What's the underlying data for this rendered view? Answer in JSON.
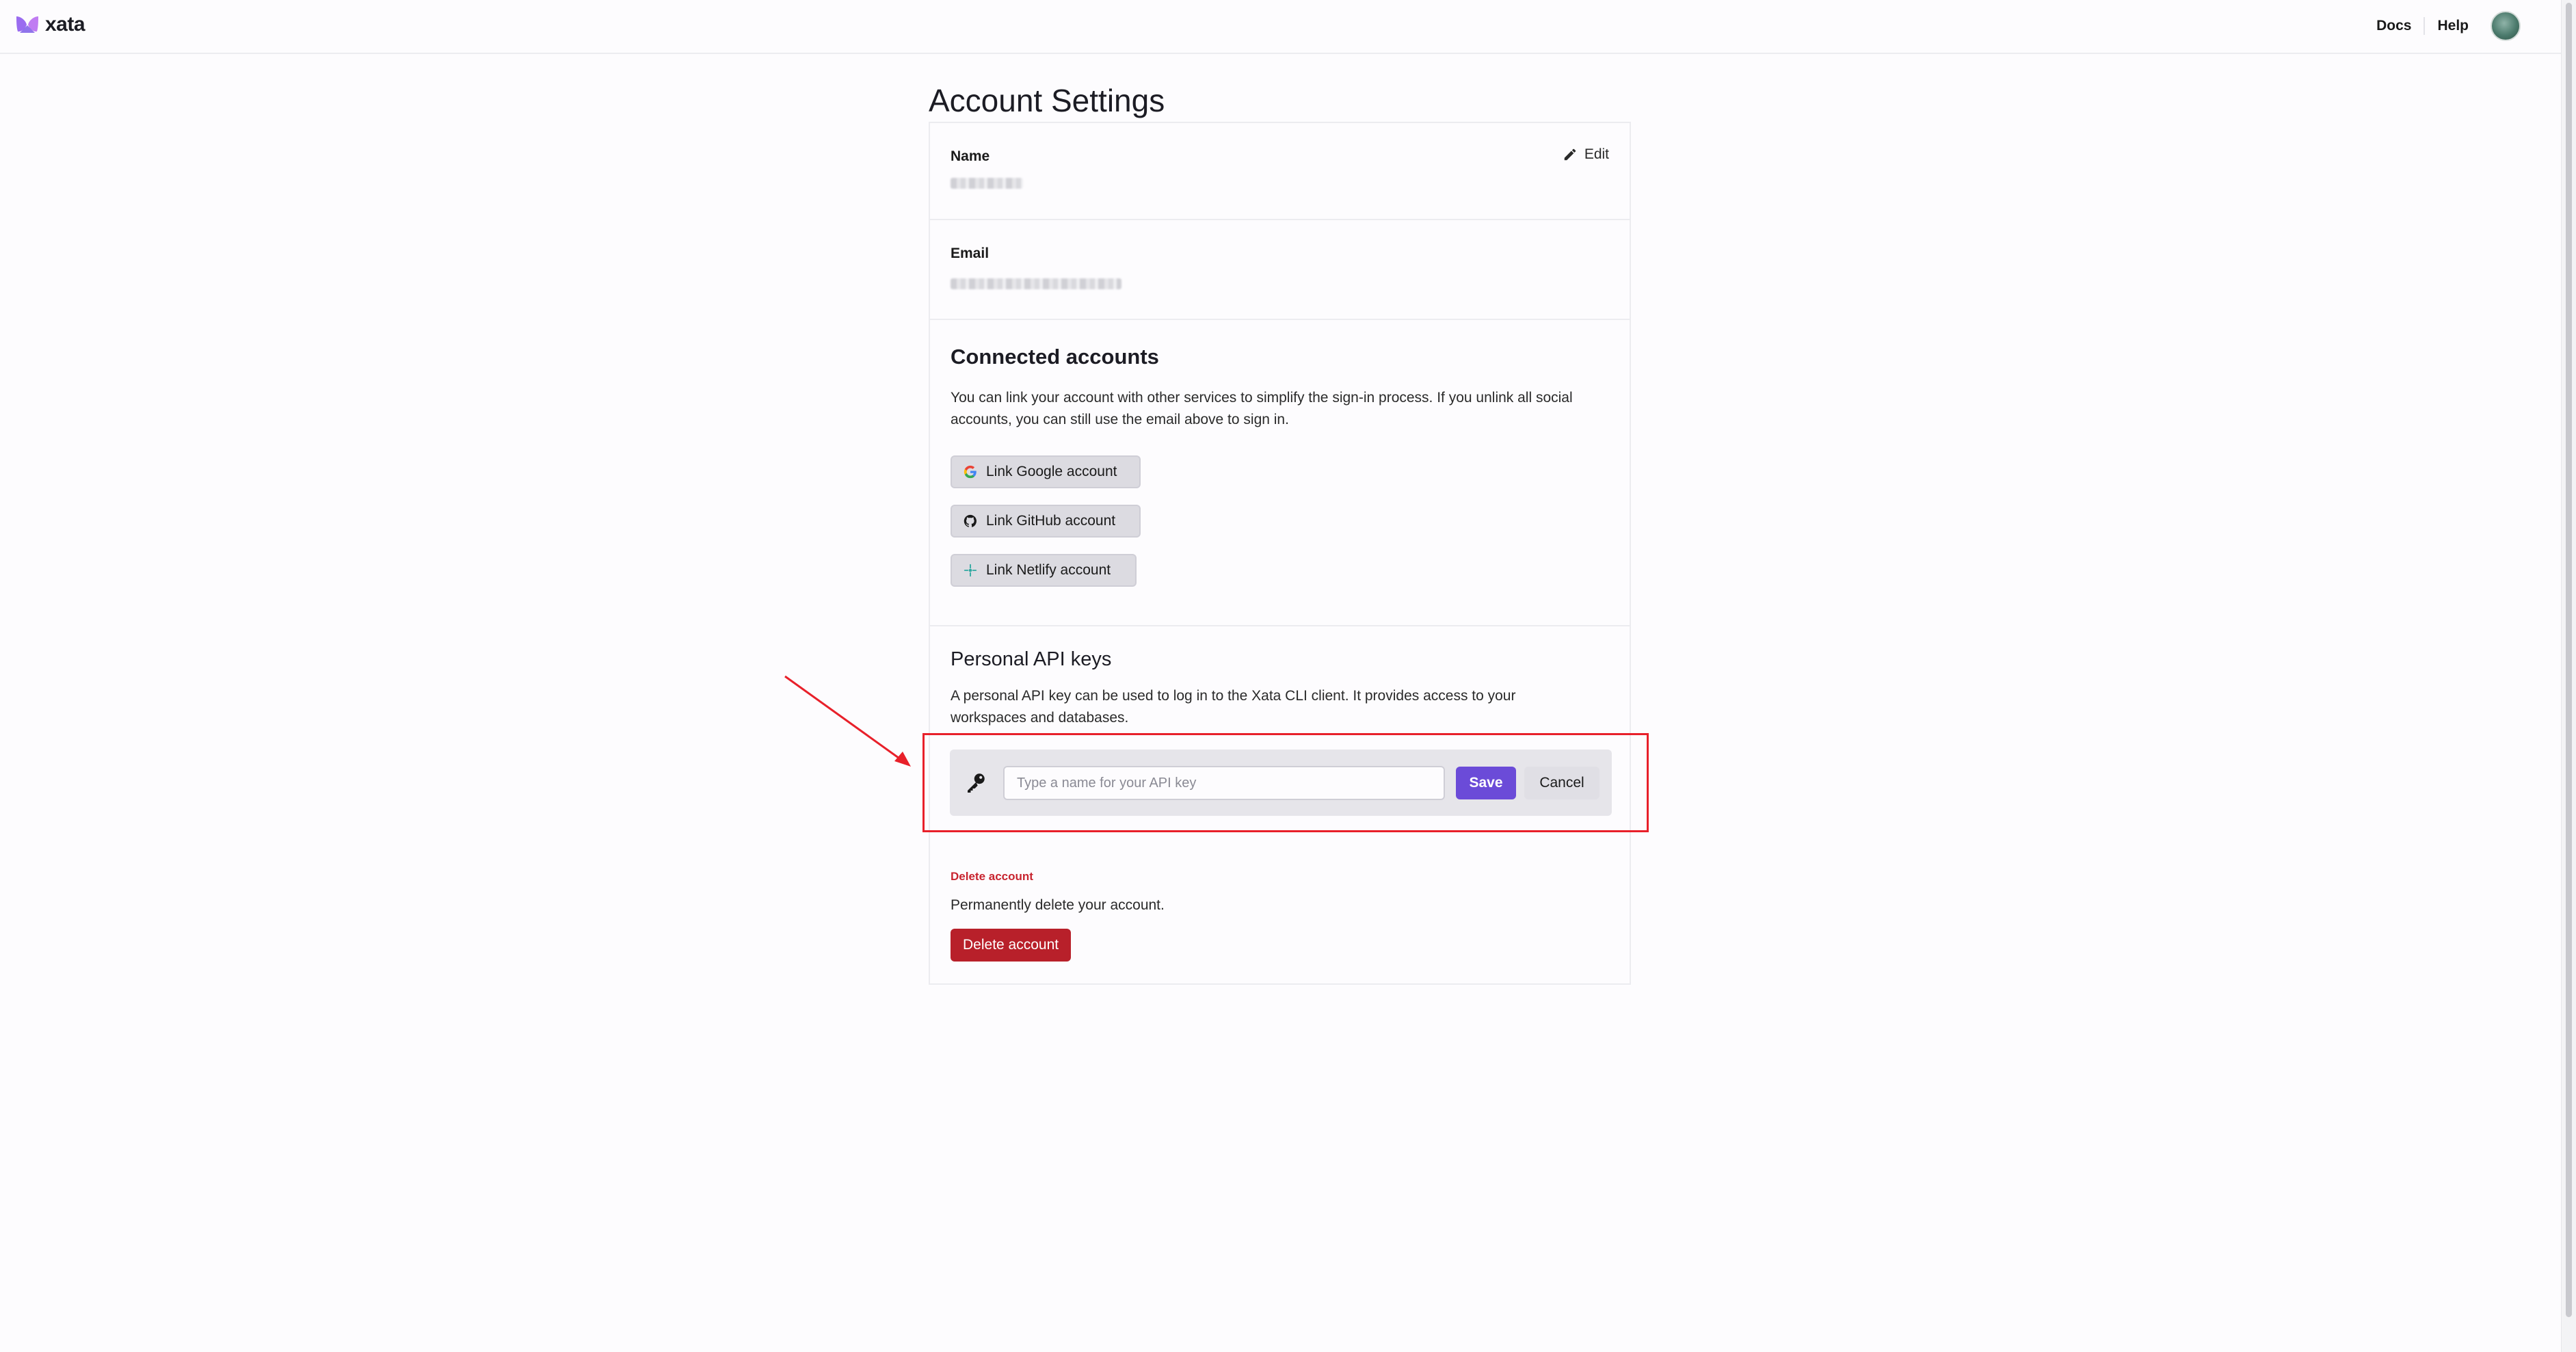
{
  "header": {
    "logo_text": "xata",
    "nav": [
      "Docs",
      "Help"
    ],
    "brand_color": "#8b5cf6"
  },
  "page": {
    "title": "Account Settings"
  },
  "profile": {
    "name_label": "Name",
    "edit_label": "Edit",
    "email_label": "Email"
  },
  "connected_accounts": {
    "title": "Connected accounts",
    "description": "You can link your account with other services to simplify the sign-in process. If you unlink all social accounts, you can still use the email above to sign in.",
    "buttons": [
      {
        "label": "Link Google account",
        "icon": "google-icon"
      },
      {
        "label": "Link GitHub account",
        "icon": "github-icon"
      },
      {
        "label": "Link Netlify account",
        "icon": "netlify-icon"
      }
    ]
  },
  "api_keys": {
    "title": "Personal API keys",
    "description": "A personal API key can be used to log in to the Xata CLI client. It provides access to your workspaces and databases.",
    "input_value": "",
    "input_placeholder": "Type a name for your API key",
    "save_label": "Save",
    "cancel_label": "Cancel",
    "save_color": "#6b4bd8"
  },
  "danger_zone": {
    "label": "Delete account",
    "description": "Permanently delete your account.",
    "button_label": "Delete account",
    "danger_color": "#b8202a"
  },
  "annotation": {
    "highlight_color": "#e8202a"
  }
}
